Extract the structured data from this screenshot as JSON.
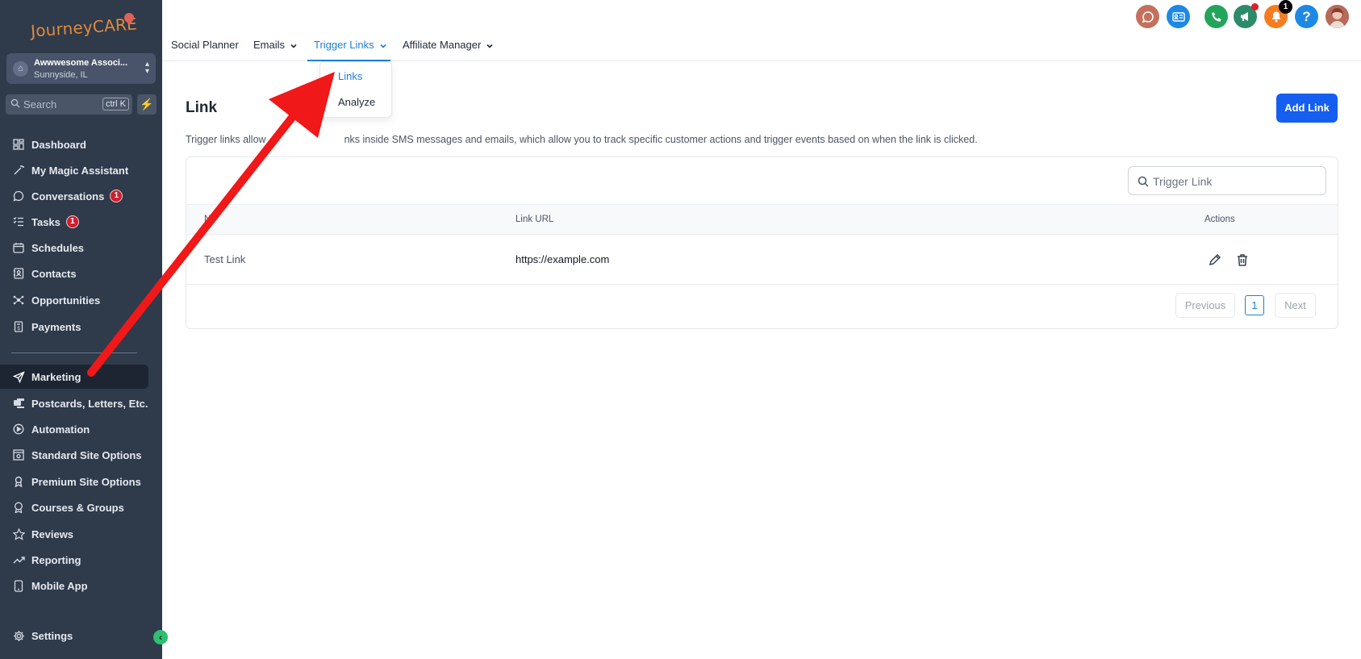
{
  "brand": {
    "logo_text": "JourneyCARE"
  },
  "account": {
    "name": "Awwwesome Associ...",
    "location": "Sunnyside, IL"
  },
  "sidebar": {
    "search_placeholder": "Search",
    "search_shortcut": "ctrl K",
    "items": [
      {
        "label": "Dashboard",
        "icon": "dashboard-icon"
      },
      {
        "label": "My Magic Assistant",
        "icon": "magic-wand-icon"
      },
      {
        "label": "Conversations",
        "icon": "chat-icon",
        "badge": "1"
      },
      {
        "label": "Tasks",
        "icon": "tasks-icon",
        "badge": "1"
      },
      {
        "label": "Schedules",
        "icon": "calendar-icon"
      },
      {
        "label": "Contacts",
        "icon": "contacts-icon"
      },
      {
        "label": "Opportunities",
        "icon": "opportunities-icon"
      },
      {
        "label": "Payments",
        "icon": "payments-icon"
      },
      {
        "label": "Marketing",
        "icon": "send-icon",
        "active": true
      },
      {
        "label": "Postcards, Letters, Etc.",
        "icon": "postcards-icon"
      },
      {
        "label": "Automation",
        "icon": "automation-icon"
      },
      {
        "label": "Standard Site Options",
        "icon": "site-icon"
      },
      {
        "label": "Premium Site Options",
        "icon": "award-icon"
      },
      {
        "label": "Courses & Groups",
        "icon": "badge-icon"
      },
      {
        "label": "Reviews",
        "icon": "star-icon"
      },
      {
        "label": "Reporting",
        "icon": "trend-icon"
      },
      {
        "label": "Mobile App",
        "icon": "phone-icon"
      },
      {
        "label": "Settings",
        "icon": "gear-icon"
      }
    ]
  },
  "topnav": {
    "tabs": [
      {
        "label": "Social Planner"
      },
      {
        "label": "Emails"
      },
      {
        "label": "Trigger Links",
        "active": true
      },
      {
        "label": "Affiliate Manager"
      }
    ],
    "dropdown": [
      "Links",
      "Analyze"
    ]
  },
  "header": {
    "notification_count": "1",
    "icon_colors": {
      "chat": "#c4705c",
      "contact_card": "#1e88e5",
      "phone": "#22a55b",
      "megaphone": "#2e8b69",
      "bell": "#f57c1f",
      "help": "#1e88e5"
    }
  },
  "main": {
    "title": "Link",
    "add_button": "Add Link",
    "description_start": "Trigger links allow",
    "description_end": "nks inside SMS messages and emails, which allow you to track specific customer actions and trigger events based on when the link is clicked.",
    "search_placeholder": "Trigger Link",
    "columns": [
      "N",
      "Link URL",
      "Actions"
    ],
    "rows": [
      {
        "name": "Test Link",
        "url": "https://example.com"
      }
    ],
    "pagination": {
      "previous": "Previous",
      "current": "1",
      "next": "Next"
    }
  },
  "colors": {
    "sidebar_bg": "#2f3a4b",
    "accent": "#1e7fd6",
    "primary_button": "#155eef",
    "annotation_arrow": "#f01818"
  }
}
